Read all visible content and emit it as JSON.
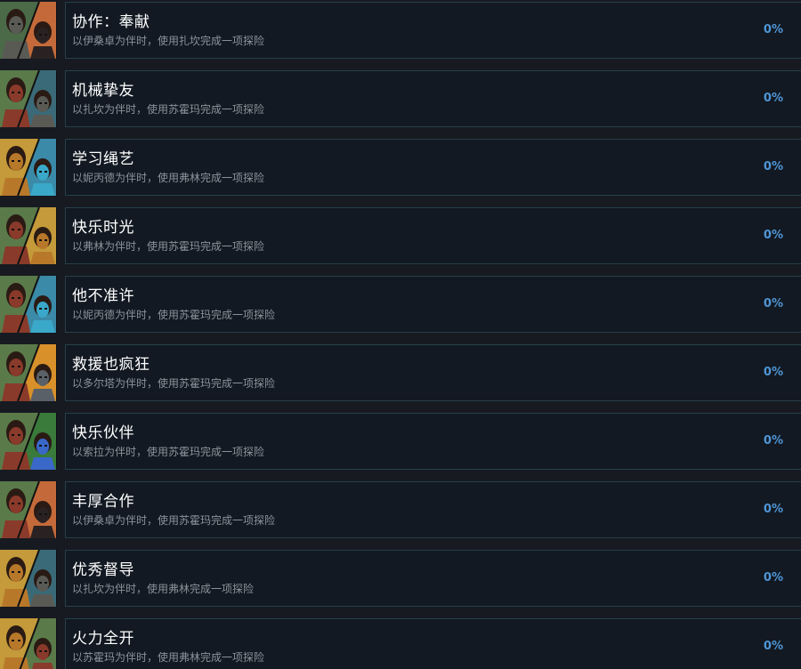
{
  "achievements": [
    {
      "title": "协作：奉献",
      "description": "以伊桑卓为伴时，使用扎坎完成一项探险",
      "percent": "0%",
      "icon": "zakan-isandra-portrait-icon",
      "colors": {
        "bg1": "#4a6a48",
        "bg2": "#c46a3a",
        "c1": "#5a5a55",
        "c2": "#2a2222"
      }
    },
    {
      "title": "机械挚友",
      "description": "以扎坎为伴时，使用苏霍玛完成一项探险",
      "percent": "0%",
      "icon": "suhoma-zakan-portrait-icon",
      "colors": {
        "bg1": "#5a7a4a",
        "bg2": "#3a6a78",
        "c1": "#8a3a2a",
        "c2": "#5a5a55"
      }
    },
    {
      "title": "学习绳艺",
      "description": "以妮丙德为伴时，使用弗林完成一项探险",
      "percent": "0%",
      "icon": "flynn-nibide-portrait-icon",
      "colors": {
        "bg1": "#c49a3a",
        "bg2": "#3a8aa8",
        "c1": "#b8782a",
        "c2": "#3aa8c8"
      }
    },
    {
      "title": "快乐时光",
      "description": "以弗林为伴时，使用苏霍玛完成一项探险",
      "percent": "0%",
      "icon": "suhoma-flynn-portrait-icon",
      "colors": {
        "bg1": "#5a7a4a",
        "bg2": "#c49a3a",
        "c1": "#8a3a2a",
        "c2": "#b8782a"
      }
    },
    {
      "title": "他不准许",
      "description": "以妮丙德为伴时，使用苏霍玛完成一项探险",
      "percent": "0%",
      "icon": "suhoma-nibide-portrait-icon",
      "colors": {
        "bg1": "#5a7a4a",
        "bg2": "#3a8aa8",
        "c1": "#8a3a2a",
        "c2": "#3aa8c8"
      }
    },
    {
      "title": "救援也疯狂",
      "description": "以多尔塔为伴时，使用苏霍玛完成一项探险",
      "percent": "0%",
      "icon": "suhoma-dorta-portrait-icon",
      "colors": {
        "bg1": "#5a7a4a",
        "bg2": "#d8902a",
        "c1": "#8a3a2a",
        "c2": "#5a6068"
      }
    },
    {
      "title": "快乐伙伴",
      "description": "以索拉为伴时，使用苏霍玛完成一项探险",
      "percent": "0%",
      "icon": "suhoma-sora-portrait-icon",
      "colors": {
        "bg1": "#5a7a4a",
        "bg2": "#3a7a3a",
        "c1": "#8a3a2a",
        "c2": "#3a68c8"
      }
    },
    {
      "title": "丰厚合作",
      "description": "以伊桑卓为伴时，使用苏霍玛完成一项探险",
      "percent": "0%",
      "icon": "suhoma-isandra-portrait-icon",
      "colors": {
        "bg1": "#5a7a4a",
        "bg2": "#c46a3a",
        "c1": "#8a3a2a",
        "c2": "#2a2222"
      }
    },
    {
      "title": "优秀督导",
      "description": "以扎坎为伴时，使用弗林完成一项探险",
      "percent": "0%",
      "icon": "flynn-zakan-portrait-icon",
      "colors": {
        "bg1": "#c49a3a",
        "bg2": "#3a6a78",
        "c1": "#b8782a",
        "c2": "#5a5a55"
      }
    },
    {
      "title": "火力全开",
      "description": "以苏霍玛为伴时，使用弗林完成一项探险",
      "percent": "0%",
      "icon": "flynn-suhoma-portrait-icon",
      "colors": {
        "bg1": "#c49a3a",
        "bg2": "#5a7a4a",
        "c1": "#b8782a",
        "c2": "#8a3a2a"
      }
    }
  ]
}
